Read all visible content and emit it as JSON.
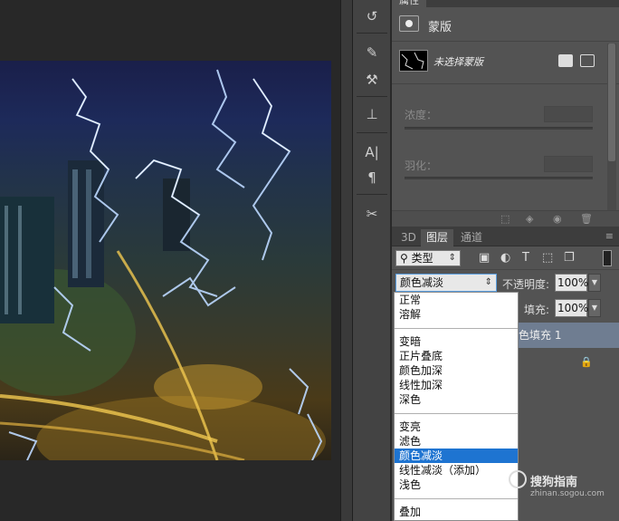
{
  "properties": {
    "tab_label": "属性",
    "title": "蒙版",
    "mask_state": "未选择蒙版",
    "density_label": "浓度：",
    "feather_label": "羽化："
  },
  "toolstrip": {
    "icons": [
      "history-icon",
      "brush-presets-icon",
      "tool-presets-icon",
      "clone-source-icon",
      "character-icon",
      "paragraph-icon",
      "tools-icon"
    ]
  },
  "layers": {
    "tabs": [
      "3D",
      "图层",
      "通道"
    ],
    "active_tab": "图层",
    "filter_value": "类型",
    "blend_mode": "颜色减淡",
    "opacity_label": "不透明度:",
    "opacity_value": "100%",
    "fill_label": "填充:",
    "fill_value": "100%",
    "layer_name": "色填充 1"
  },
  "blend_dropdown": {
    "groups": [
      [
        "正常",
        "溶解"
      ],
      [
        "变暗",
        "正片叠底",
        "颜色加深",
        "线性加深",
        "深色"
      ],
      [
        "变亮",
        "滤色",
        "颜色减淡",
        "线性减淡（添加）",
        "浅色"
      ],
      [
        "叠加"
      ]
    ],
    "selected": "颜色减淡"
  },
  "watermark": {
    "brand": "搜狗指南",
    "url": "zhinan.sogou.com"
  },
  "colors": {
    "panel_bg": "#535353",
    "selection_blue": "#1e74d1",
    "layer_highlight": "#6f7d91"
  }
}
